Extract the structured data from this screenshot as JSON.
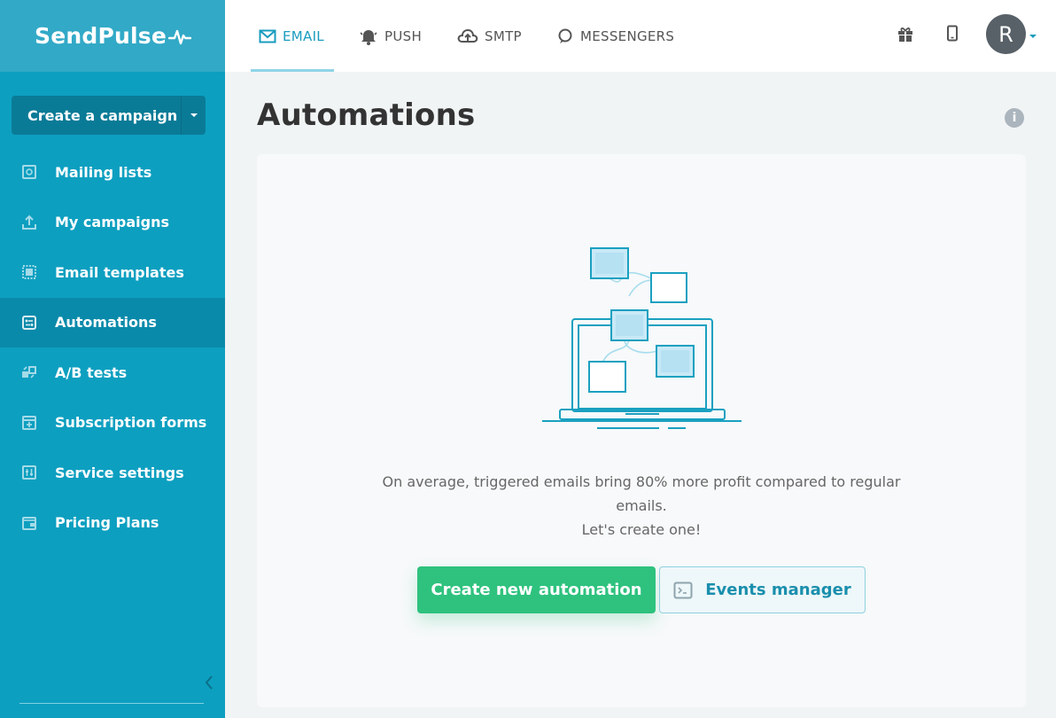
{
  "app": {
    "logo_text": "SendPulse"
  },
  "sidebar": {
    "create_label": "Create a campaign",
    "items": [
      {
        "label": "Mailing lists",
        "icon": "mailing-lists-icon"
      },
      {
        "label": "My campaigns",
        "icon": "campaigns-icon"
      },
      {
        "label": "Email templates",
        "icon": "templates-icon"
      },
      {
        "label": "Automations",
        "icon": "automations-icon",
        "active": true
      },
      {
        "label": "A/B tests",
        "icon": "ab-tests-icon"
      },
      {
        "label": "Subscription forms",
        "icon": "forms-icon"
      },
      {
        "label": "Service settings",
        "icon": "settings-icon"
      },
      {
        "label": "Pricing Plans",
        "icon": "wallet-icon"
      }
    ]
  },
  "topbar": {
    "tabs": [
      {
        "label": "EMAIL",
        "icon": "envelope-icon",
        "active": true
      },
      {
        "label": "PUSH",
        "icon": "bell-icon"
      },
      {
        "label": "SMTP",
        "icon": "cloud-upload-icon"
      },
      {
        "label": "MESSENGERS",
        "icon": "chat-icon"
      }
    ],
    "avatar_initial": "R"
  },
  "main": {
    "title": "Automations",
    "message_line1": "On average, triggered emails bring 80% more profit compared to regular emails.",
    "message_line2": "Let's create one!",
    "primary_button": "Create new automation",
    "secondary_button": "Events manager"
  },
  "colors": {
    "sidebar": "#0d9fc0",
    "accent": "#1a9cbf",
    "green": "#2ec27e"
  }
}
